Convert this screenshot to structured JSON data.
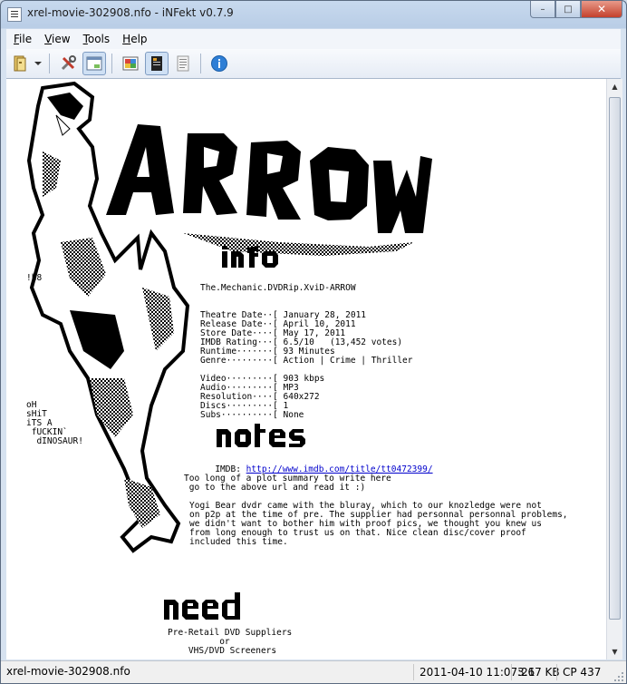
{
  "window": {
    "title": "xrel-movie-302908.nfo - iNFekt v0.7.9",
    "buttons": {
      "minimize": "–",
      "maximize": "□",
      "close": "✕"
    }
  },
  "menu": [
    "File",
    "View",
    "Tools",
    "Help"
  ],
  "toolbar": {
    "icons": [
      "open-file-icon",
      "dropdown-arrow-icon",
      "settings-tools-icon",
      "rendered-view-icon",
      "color-palette-icon",
      "classic-view-icon",
      "text-only-view-icon",
      "info-icon"
    ]
  },
  "nfo": {
    "side_left_1": "!h8",
    "side_left_2": "oH\nsHiT\niTS A\n fUCKIN`\n  dINOSAUR!",
    "release_name": "The.Mechanic.DVDRip.XviD-ARROW",
    "info_block": "Theatre Date··[ January 28, 2011\nRelease Date··[ April 10, 2011\nStore Date····[ May 17, 2011\nIMDB Rating···[ 6.5/10   (13,452 votes)\nRuntime·······[ 93 Minutes\nGenre·········[ Action | Crime | Thriller",
    "tech_block": "Video·········[ 903 kbps\nAudio·········[ MP3\nResolution····[ 640x272\nDiscs·········[ 1\nSubs··········[ None",
    "imdb_label": "IMDB: ",
    "imdb_url": "http://www.imdb.com/title/tt0472399/",
    "plot": "Too long of a plot summary to write here\n go to the above url and read it :)",
    "notes": "Yogi Bear dvdr came with the bluray, which to our knozledge were not\non p2p at the time of pre. The supplier had personnal personnal problems,\nwe didn't want to bother him with proof pics, we thought you knew us\nfrom long enough to trust us on that. Nice clean disc/cover proof\nincluded this time.",
    "need_block": "Pre-Retail DVD Suppliers\n          or\n    VHS/DVD Screeners"
  },
  "statusbar": {
    "file": "xrel-movie-302908.nfo",
    "date": "2011-04-10 11:07:21",
    "size": "3.67 KB",
    "codepage": "CP 437"
  }
}
